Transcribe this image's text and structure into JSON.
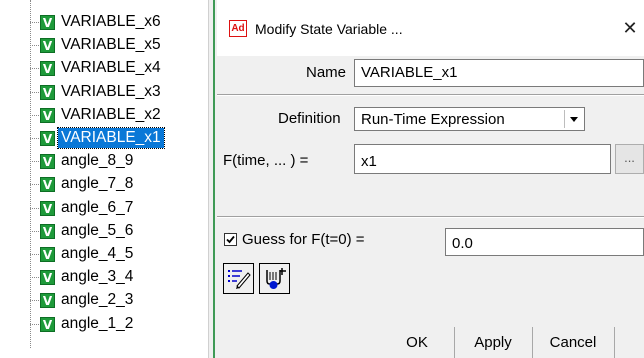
{
  "tree": {
    "items": [
      {
        "label": "VARIABLE_x6",
        "selected": false
      },
      {
        "label": "VARIABLE_x5",
        "selected": false
      },
      {
        "label": "VARIABLE_x4",
        "selected": false
      },
      {
        "label": "VARIABLE_x3",
        "selected": false
      },
      {
        "label": "VARIABLE_x2",
        "selected": false
      },
      {
        "label": "VARIABLE_x1",
        "selected": true
      },
      {
        "label": "angle_8_9",
        "selected": false
      },
      {
        "label": "angle_7_8",
        "selected": false
      },
      {
        "label": "angle_6_7",
        "selected": false
      },
      {
        "label": "angle_5_6",
        "selected": false
      },
      {
        "label": "angle_4_5",
        "selected": false
      },
      {
        "label": "angle_3_4",
        "selected": false
      },
      {
        "label": "angle_2_3",
        "selected": false
      },
      {
        "label": "angle_1_2",
        "selected": false
      }
    ],
    "item_icon_glyph": "V"
  },
  "dialog": {
    "app_icon_text": "Ad",
    "title": "Modify State Variable ...",
    "close_glyph": "✕",
    "name_label": "Name",
    "name_value": "VARIABLE_x1",
    "definition_label": "Definition",
    "definition_value": "Run-Time Expression",
    "ftime_label": "F(time, ... ) =",
    "ftime_value": "x1",
    "browse_label": "...",
    "guess_label": "Guess for F(t=0) =",
    "guess_checked": true,
    "guess_value": "0.0",
    "ok_label": "OK",
    "apply_label": "Apply",
    "cancel_label": "Cancel"
  },
  "colors": {
    "selection": "#0a78d7",
    "variable_icon": "#1e9a3a",
    "dialog_bg": "#f0f0f0"
  }
}
